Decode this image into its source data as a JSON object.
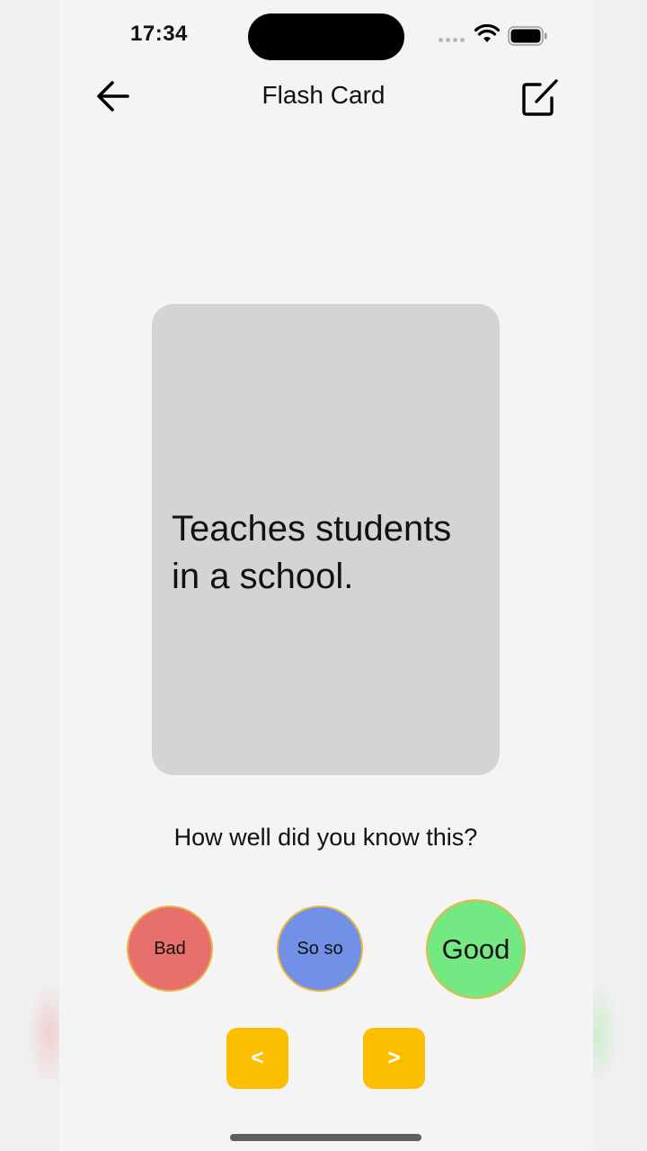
{
  "status_bar": {
    "time": "17:34"
  },
  "header": {
    "title": "Flash Card",
    "back_icon": "arrow-left-icon",
    "edit_icon": "edit-square-icon"
  },
  "card": {
    "text": "Teaches students in a school."
  },
  "rating": {
    "question": "How well did you know this?",
    "bad_label": "Bad",
    "soso_label": "So so",
    "good_label": "Good"
  },
  "navigation": {
    "prev_label": "<",
    "next_label": ">"
  },
  "colors": {
    "bad": "#e8706c",
    "soso": "#7291e6",
    "good": "#74e882",
    "nav_button": "#fcc000",
    "card_background": "#d4d4d4"
  }
}
